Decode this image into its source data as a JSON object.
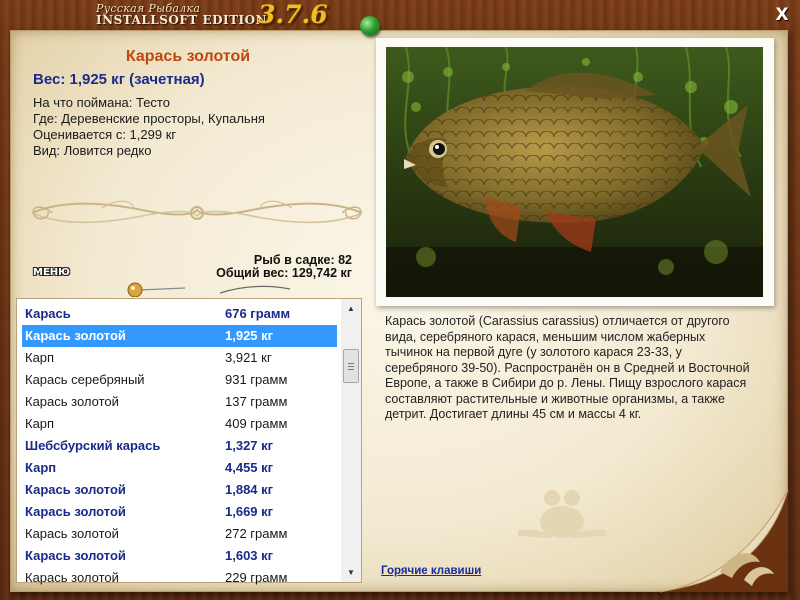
{
  "window": {
    "brand_top": "Русская Рыбалка",
    "brand_bottom": "INSTALLSOFT EDITION",
    "version": "3.7.6",
    "close_label": "X"
  },
  "fish": {
    "title": "Карась золотой",
    "weight_line": "Вес: 1,925 кг (зачетная)",
    "info_lines": [
      "На что поймана: Тесто",
      "Где: Деревенские просторы, Купальня",
      "Оценивается с: 1,299 кг",
      "Вид: Ловится редко"
    ]
  },
  "menu_label": "МЕНЮ",
  "keepnet": {
    "count_line": "Рыб в садке: 82",
    "total_line": "Общий вес: 129,742 кг"
  },
  "catch_list": [
    {
      "name": "Карась",
      "weight": "676 грамм",
      "style": "bold"
    },
    {
      "name": "Карась золотой",
      "weight": "1,925 кг",
      "style": "selected"
    },
    {
      "name": "Карп",
      "weight": "3,921 кг",
      "style": "normal"
    },
    {
      "name": "Карась серебряный",
      "weight": "931 грамм",
      "style": "normal"
    },
    {
      "name": "Карась золотой",
      "weight": "137 грамм",
      "style": "normal"
    },
    {
      "name": "Карп",
      "weight": "409 грамм",
      "style": "normal"
    },
    {
      "name": "Шебсбурский карась",
      "weight": "1,327 кг",
      "style": "bold"
    },
    {
      "name": "Карп",
      "weight": "4,455 кг",
      "style": "bold"
    },
    {
      "name": "Карась золотой",
      "weight": "1,884 кг",
      "style": "bold"
    },
    {
      "name": "Карась золотой",
      "weight": "1,669 кг",
      "style": "bold"
    },
    {
      "name": "Карась золотой",
      "weight": "272 грамм",
      "style": "normal"
    },
    {
      "name": "Карась золотой",
      "weight": "1,603 кг",
      "style": "bold"
    },
    {
      "name": "Карась золотой",
      "weight": "229 грамм",
      "style": "normal"
    }
  ],
  "description": "Карась золотой (Carassius carassius) отличается от другого вида, серебряного карася, меньшим числом жаберных тычинок на первой дуге (у золотого карася 23-33, у серебряного 39-50). Распространён он в Средней и Восточной Европе, а также в Сибири до р. Лены. Пищу взрослого карася составляют растительные и животные организмы, а также детрит. Достигает длины 45 см и массы 4 кг.",
  "hotkeys_label": "Горячие клавиши",
  "colors": {
    "title_orange": "#c0470e",
    "weight_blue": "#1c2a8c",
    "bold_row_blue": "#1a2a8a",
    "selection_blue": "#3399ff",
    "parchment": "#f3ead2",
    "wood": "#6b3212"
  },
  "icons": {
    "close": "close-icon",
    "pin_green": "green-pin-icon",
    "pin_gold": "gold-pin-icon",
    "scroll_up": "scroll-up-arrow-icon",
    "scroll_down": "scroll-down-arrow-icon"
  }
}
